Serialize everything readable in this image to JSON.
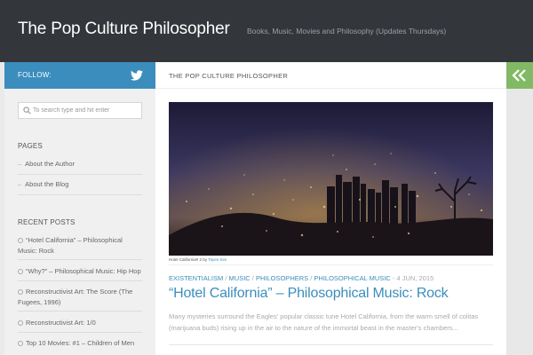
{
  "header": {
    "site_title": "The Pop Culture Philosopher",
    "tagline": "Books, Music, Movies and Philosophy (Updates Thursdays)"
  },
  "sidebar": {
    "follow_label": "FOLLOW:",
    "search_placeholder": "To search type and hit enter",
    "pages_title": "PAGES",
    "pages": [
      {
        "label": "About the Author"
      },
      {
        "label": "About the Blog"
      }
    ],
    "recent_title": "RECENT POSTS",
    "recent_posts": [
      {
        "label": "“Hotel California” – Philosophical Music: Rock"
      },
      {
        "label": "“Why?” – Philosophical Music: Hip Hop"
      },
      {
        "label": "Reconstructivist Art: The Score (The Fugees, 1996)"
      },
      {
        "label": "Reconstructivist Art: 1/0"
      },
      {
        "label": "Top 10 Movies: #1 – Children of Men"
      }
    ]
  },
  "main": {
    "header_title": "THE POP CULTURE PHILOSOPHER",
    "caption": {
      "text": "Hotel California# 2 by ",
      "link": "Tayen Kim"
    },
    "post": {
      "categories": [
        "EXISTENTIALISM",
        "MUSIC",
        "PHILOSOPHERS",
        "PHILOSOPHICAL MUSIC"
      ],
      "date": "4 JUN, 2015",
      "title": "“Hotel California” – Philosophical Music: Rock",
      "excerpt": "Many mysteries surround the Eagles' popular classic tune Hotel California, from the warm smell of colitas (marijuana buds) rising up in the air to the nature of the immortal beast in the master's chambers..."
    }
  },
  "colors": {
    "header_bg": "#33363b",
    "follow_bg": "#3b8dbd",
    "accent": "#3b8dbd",
    "toggle_bg": "#82b965"
  },
  "icons": {
    "twitter": "twitter-icon",
    "search": "search-icon",
    "toggle": "double-chevron-left-icon"
  }
}
